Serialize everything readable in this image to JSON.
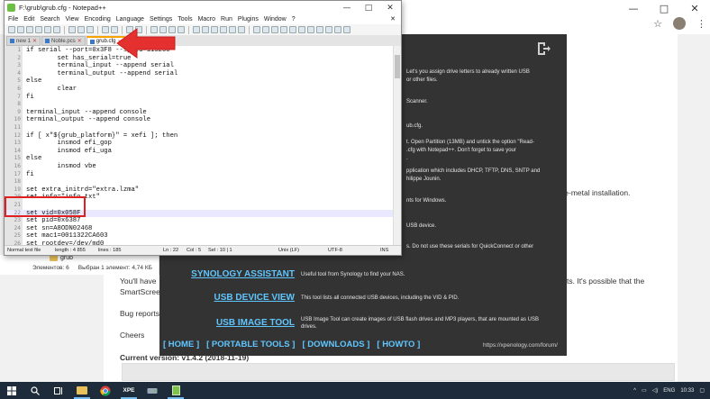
{
  "browser": {
    "window_controls": {
      "minimize": "—",
      "maximize": "□",
      "close": "✕"
    },
    "page_fragments": {
      "bare_metal": "bare-metal installation.",
      "youll_have": "You'll have",
      "smartscreen": "SmartScree",
      "bug_reports": "Bug reports",
      "cheers": "Cheers",
      "its_possible": "ts. It's possible that the",
      "current_version": "Current version: v1.4.2 (2018-11-19)"
    }
  },
  "apenology": {
    "intro_lines": [
      "Let's you assign drive letters to already written USB",
      "or other files."
    ],
    "scanner_text": "Scanner.",
    "grub_text": "ub.cfg.",
    "partition_lines": [
      "t. Open Partition (13MB) and untick the option \"Read-",
      ".cfg with Notepad++. Don't forget to save your",
      "."
    ],
    "app_lines": [
      "pplication which includes DHCP, TFTP, DNS, SNTP and",
      "hilippe Jounin."
    ],
    "windows_text": "nts for Windows.",
    "usb_device_text": "USB device.",
    "serials_text": "s. Do not use these serials for QuickConnect or other",
    "tools": [
      {
        "name": "SYNOLOGY ASSISTANT",
        "description": "Useful tool from Synology to find your NAS."
      },
      {
        "name": "USB DEVICE VIEW",
        "description": "This tool lists all connected USB devices, including the VID & PID."
      },
      {
        "name": "USB IMAGE TOOL",
        "description": "USB Image Tool can create images of USB flash drives and MP3 players, that are mounted as USB drives."
      }
    ],
    "nav": [
      "[ HOME ]",
      "[ PORTABLE TOOLS ]",
      "[ DOWNLOADS ]",
      "[ HOWTO ]"
    ],
    "forum_url": "https://xpenology.com/forum/"
  },
  "explorer": {
    "folder_name": "grub",
    "item_count": "Элементов: 6",
    "selection": "Выбран 1 элемент: 4,74 КБ"
  },
  "notepad": {
    "title": "F:\\grub\\grub.cfg - Notepad++",
    "window_controls": {
      "minimize": "—",
      "maximize": "□",
      "close": "✕"
    },
    "menu": [
      "File",
      "Edit",
      "Search",
      "View",
      "Encoding",
      "Language",
      "Settings",
      "Tools",
      "Macro",
      "Run",
      "Plugins",
      "Window",
      "?"
    ],
    "close_x": "✕",
    "tabs": [
      {
        "label": "new 1",
        "active": false
      },
      {
        "label": "Noble.pcs",
        "active": false
      },
      {
        "label": "grub.cfg",
        "active": true
      }
    ],
    "lines": [
      {
        "n": "1",
        "t": "if serial --port=0x3F8 --speed=115200"
      },
      {
        "n": "2",
        "t": "        set has_serial=true"
      },
      {
        "n": "3",
        "t": "        terminal_input --append serial"
      },
      {
        "n": "4",
        "t": "        terminal_output --append serial"
      },
      {
        "n": "5",
        "t": "else"
      },
      {
        "n": "6",
        "t": "        clear"
      },
      {
        "n": "7",
        "t": "fi"
      },
      {
        "n": "8",
        "t": ""
      },
      {
        "n": "9",
        "t": "terminal_input --append console"
      },
      {
        "n": "10",
        "t": "terminal_output --append console"
      },
      {
        "n": "11",
        "t": ""
      },
      {
        "n": "12",
        "t": "if [ x\"${grub_platform}\" = xefi ]; then"
      },
      {
        "n": "13",
        "t": "        insmod efi_gop"
      },
      {
        "n": "14",
        "t": "        insmod efi_uga"
      },
      {
        "n": "15",
        "t": "else"
      },
      {
        "n": "16",
        "t": "        insmod vbe"
      },
      {
        "n": "17",
        "t": "fi"
      },
      {
        "n": "18",
        "t": ""
      },
      {
        "n": "19",
        "t": "set extra_initrd=\"extra.lzma\""
      },
      {
        "n": "20",
        "t": "set info=\"info.txt\""
      },
      {
        "n": "21",
        "t": ""
      },
      {
        "n": "22",
        "t": "set vid=0x058F"
      },
      {
        "n": "23",
        "t": "set pid=0x6387"
      },
      {
        "n": "24",
        "t": "set sn=A8ODN02468"
      },
      {
        "n": "25",
        "t": "set mac1=0011322CA603"
      },
      {
        "n": "26",
        "t": "set rootdev=/dev/md0"
      }
    ],
    "current_line": "22",
    "status": {
      "file_type": "Normal text file",
      "length": "length : 4 855",
      "lines": "lines : 185",
      "ln": "Ln : 22",
      "col": "Col : 5",
      "sel": "Sel : 10 | 1",
      "eol": "Unix (LF)",
      "encoding": "UTF-8",
      "mode": "INS"
    }
  },
  "taskbar": {
    "items": [
      "start-icon",
      "search-icon",
      "task-view-icon",
      "file-explorer-icon",
      "chrome-icon",
      "xpe-icon",
      "drive-icon",
      "edge-icon",
      "notepad-icon"
    ],
    "xpe_label": "XPE",
    "lang": "ENG",
    "time": "10:33"
  },
  "colors": {
    "dark_panel": "#333333",
    "link_blue": "#5fc6ff",
    "highlight_red": "#e02020",
    "taskbar": "#1d2b3a"
  }
}
